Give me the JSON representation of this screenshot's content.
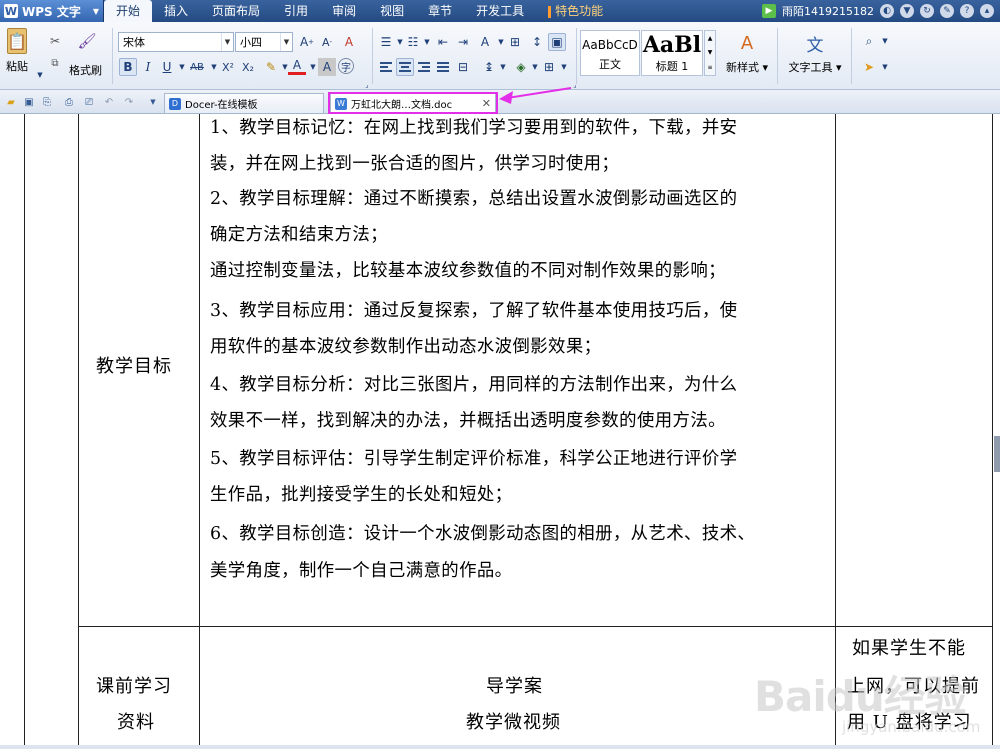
{
  "app": {
    "name": "WPS 文字",
    "logo": "W"
  },
  "menu": {
    "tabs": [
      "开始",
      "插入",
      "页面布局",
      "引用",
      "审阅",
      "视图",
      "章节",
      "开发工具",
      "特色功能"
    ],
    "active_index": 0,
    "user": "雨陌1419215182"
  },
  "ribbon": {
    "paste": "粘贴",
    "format_painter": "格式刷",
    "font_name": "宋体",
    "font_size": "小四",
    "bold": "B",
    "italic": "I",
    "underline": "U",
    "strike": "AB",
    "superscript": "X²",
    "subscript": "X₂",
    "font_color_a": "A",
    "char_shade_a": "A",
    "style_normal_preview": "AaBbCcD",
    "style_normal_label": "正文",
    "style_heading_preview": "AaBl",
    "style_heading_label": "标题 1",
    "new_style": "新样式",
    "text_tools": "文字工具"
  },
  "tabstrip": {
    "tabs": [
      {
        "label": "Docer-在线模板",
        "icon": "D"
      },
      {
        "label": "万虹北大朗…文档.doc",
        "icon": "W"
      }
    ],
    "active_index": 1
  },
  "document": {
    "goals_label": "教学目标",
    "goals_lines": [
      "1、教学目标记忆：在网上找到我们学习要用到的软件，下载，并安",
      "装，并在网上找到一张合适的图片，供学习时使用；",
      "2、教学目标理解：通过不断摸索，总结出设置水波倒影动画选区的",
      "确定方法和结束方法；",
      "通过控制变量法，比较基本波纹参数值的不同对制作效果的影响；",
      "3、教学目标应用：通过反复探索，了解了软件基本使用技巧后，使",
      "用软件的基本波纹参数制作出动态水波倒影效果；",
      "4、教学目标分析：对比三张图片，用同样的方法制作出来，为什么",
      "效果不一样，找到解决的办法，并概括出透明度参数的使用方法。",
      "5、教学目标评估：引导学生制定评价标准，科学公正地进行评价学",
      "生作品，批判接受学生的长处和短处；",
      "6、教学目标创造：设计一个水波倒影动态图的相册，从艺术、技术、",
      "美学角度，制作一个自己满意的作品。"
    ],
    "prestudy_label_1": "课前学习",
    "prestudy_label_2": "资料",
    "prestudy_content_1": "导学案",
    "prestudy_content_2": "教学微视频",
    "note_lines": [
      "如果学生不能",
      "上网，可以提前",
      "用 U 盘将学习"
    ]
  },
  "watermark": {
    "logo": "Baidu经验",
    "sub": "jingyan.baidu.com"
  },
  "colors": {
    "menu_bar": "#2f5a95",
    "highlight": "#e330e8",
    "text": "#000000"
  }
}
